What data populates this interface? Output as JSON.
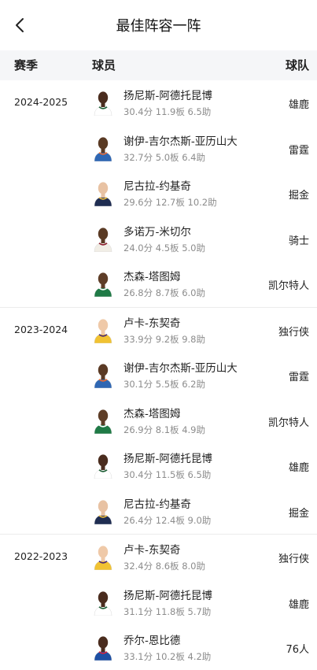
{
  "header": {
    "title": "最佳阵容一阵",
    "back_icon": "chevron-left-icon"
  },
  "columns": {
    "season": "赛季",
    "player": "球员",
    "team": "球队"
  },
  "groups": [
    {
      "season": "2024-2025",
      "players": [
        {
          "name": "扬尼斯-阿德托昆博",
          "stats": "30.4分 11.9板 6.5助",
          "team": "雄鹿",
          "skin": "#4a2c1e",
          "jersey": "#ffffff",
          "trim": "#1d5e35"
        },
        {
          "name": "谢伊-吉尔杰斯-亚历山大",
          "stats": "32.7分 5.0板 6.4助",
          "team": "雷霆",
          "skin": "#5a3a24",
          "jersey": "#2f67b3",
          "trim": "#f06a2a"
        },
        {
          "name": "尼古拉-约基奇",
          "stats": "29.6分 12.7板 10.2助",
          "team": "掘金",
          "skin": "#e8c2a3",
          "jersey": "#1f2d52",
          "trim": "#f5c242"
        },
        {
          "name": "多诺万-米切尔",
          "stats": "24.0分 4.5板 5.0助",
          "team": "骑士",
          "skin": "#5a3a24",
          "jersey": "#f1eee6",
          "trim": "#8a1c2b"
        },
        {
          "name": "杰森-塔图姆",
          "stats": "26.8分 8.7板 6.0助",
          "team": "凯尔特人",
          "skin": "#5e3d27",
          "jersey": "#1f7a46",
          "trim": "#ffffff"
        }
      ]
    },
    {
      "season": "2023-2024",
      "players": [
        {
          "name": "卢卡-东契奇",
          "stats": "33.9分 9.2板 9.8助",
          "team": "独行侠",
          "skin": "#efc9a8",
          "jersey": "#f1c232",
          "trim": "#4b2a7a"
        },
        {
          "name": "谢伊-吉尔杰斯-亚历山大",
          "stats": "30.1分 5.5板 6.2助",
          "team": "雷霆",
          "skin": "#5a3a24",
          "jersey": "#2f67b3",
          "trim": "#f06a2a"
        },
        {
          "name": "杰森-塔图姆",
          "stats": "26.9分 8.1板 4.9助",
          "team": "凯尔特人",
          "skin": "#5e3d27",
          "jersey": "#1f7a46",
          "trim": "#ffffff"
        },
        {
          "name": "扬尼斯-阿德托昆博",
          "stats": "30.4分 11.5板 6.5助",
          "team": "雄鹿",
          "skin": "#4a2c1e",
          "jersey": "#ffffff",
          "trim": "#1d5e35"
        },
        {
          "name": "尼古拉-约基奇",
          "stats": "26.4分 12.4板 9.0助",
          "team": "掘金",
          "skin": "#e8c2a3",
          "jersey": "#1f2d52",
          "trim": "#f5c242"
        }
      ]
    },
    {
      "season": "2022-2023",
      "players": [
        {
          "name": "卢卡-东契奇",
          "stats": "32.4分 8.6板 8.0助",
          "team": "独行侠",
          "skin": "#efc9a8",
          "jersey": "#f1c232",
          "trim": "#4b2a7a"
        },
        {
          "name": "扬尼斯-阿德托昆博",
          "stats": "31.1分 11.8板 5.7助",
          "team": "雄鹿",
          "skin": "#4a2c1e",
          "jersey": "#ffffff",
          "trim": "#1d5e35"
        },
        {
          "name": "乔尔-恩比德",
          "stats": "33.1分 10.2板 4.2助",
          "team": "76人",
          "skin": "#4a2c1e",
          "jersey": "#1d4fa3",
          "trim": "#d8213a"
        }
      ]
    }
  ]
}
